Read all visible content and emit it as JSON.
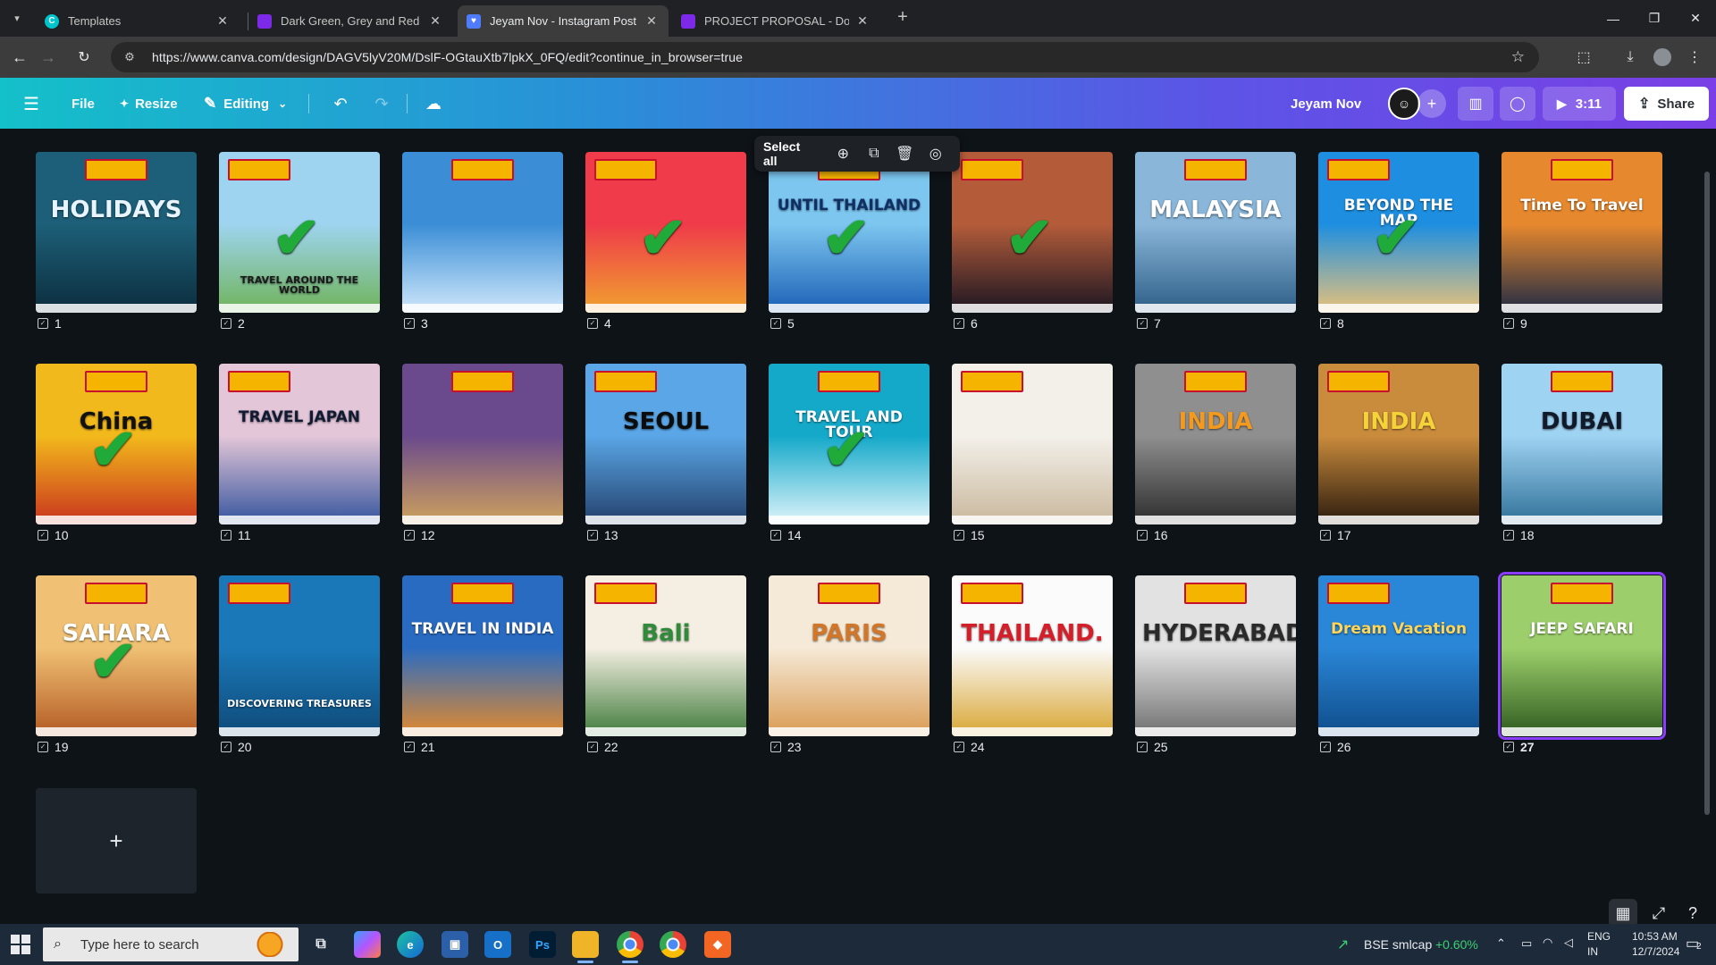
{
  "browser": {
    "tabs": [
      {
        "title": "Templates",
        "active": false,
        "favicon": "canva-icon",
        "color": "#00c4cc"
      },
      {
        "title": "Dark Green, Grey and Red Modern",
        "active": false,
        "favicon": "doc-icon",
        "color": "#7d2ae8"
      },
      {
        "title": "Jeyam Nov - Instagram Post - C",
        "active": true,
        "favicon": "heart-icon",
        "color": "#4f7bff"
      },
      {
        "title": "PROJECT PROPOSAL - Doc",
        "active": false,
        "favicon": "doc-icon",
        "color": "#7d2ae8"
      }
    ],
    "url": "https://www.canva.com/design/DAGV5lyV20M/DslF-OGtauXtb7lpkX_0FQ/edit?continue_in_browser=true"
  },
  "header": {
    "file_label": "File",
    "resize_label": "Resize",
    "editing_label": "Editing",
    "design_title": "Jeyam Nov",
    "play_time": "3:11",
    "share_label": "Share"
  },
  "selection_toolbar": {
    "select_all_label": "Select all"
  },
  "pages": [
    {
      "num": "1",
      "title": "HOLIDAYS",
      "bg": "#1d5f78",
      "bg2": "#0c2d3d",
      "title_color": "#e8f4ff",
      "checked": false
    },
    {
      "num": "2",
      "title": "TRAVEL AROUND THE WORLD",
      "bg": "#9ed4ef",
      "bg2": "#6fb35a",
      "title_color": "#1a1a1a",
      "checked": true
    },
    {
      "num": "3",
      "title": "",
      "bg": "#3b8ed6",
      "bg2": "#cfe7fb",
      "title_color": "#ffffff",
      "checked": false
    },
    {
      "num": "4",
      "title": "",
      "bg": "#ef3b4a",
      "bg2": "#f0a22e",
      "title_color": "#ffffff",
      "checked": true
    },
    {
      "num": "5",
      "title": "UNTIL THAILAND",
      "bg": "#7cc6ef",
      "bg2": "#1a5fb5",
      "title_color": "#0f2f66",
      "checked": true
    },
    {
      "num": "6",
      "title": "",
      "bg": "#b45c3a",
      "bg2": "#1b1522",
      "title_color": "#ffffff",
      "checked": true
    },
    {
      "num": "7",
      "title": "MALAYSIA",
      "bg": "#89b6d9",
      "bg2": "#2d5d86",
      "title_color": "#ffffff",
      "checked": false
    },
    {
      "num": "8",
      "title": "BEYOND THE MAP",
      "bg": "#1e8fe0",
      "bg2": "#e9c27a",
      "title_color": "#ffffff",
      "checked": true
    },
    {
      "num": "9",
      "title": "Time To Travel",
      "bg": "#e6882e",
      "bg2": "#1f2a44",
      "title_color": "#ffffff",
      "checked": false
    },
    {
      "num": "10",
      "title": "China",
      "bg": "#f2b91c",
      "bg2": "#c9331e",
      "title_color": "#111111",
      "checked": true
    },
    {
      "num": "11",
      "title": "TRAVEL JAPAN",
      "bg": "#e3c6d8",
      "bg2": "#35549d",
      "title_color": "#111a33",
      "checked": false
    },
    {
      "num": "12",
      "title": "",
      "bg": "#6a4a8c",
      "bg2": "#cfa35c",
      "title_color": "#ffffff",
      "checked": false
    },
    {
      "num": "13",
      "title": "SEOUL",
      "bg": "#5aa6e6",
      "bg2": "#23406b",
      "title_color": "#0c0c0c",
      "checked": false
    },
    {
      "num": "14",
      "title": "TRAVEL AND TOUR",
      "bg": "#14a9c9",
      "bg2": "#e0f4fb",
      "title_color": "#ffffff",
      "checked": true
    },
    {
      "num": "15",
      "title": "",
      "bg": "#f3f0ea",
      "bg2": "#c9b79c",
      "title_color": "#333333",
      "checked": false
    },
    {
      "num": "16",
      "title": "INDIA",
      "bg": "#8f8f8f",
      "bg2": "#2b2b2b",
      "title_color": "#f39a1e",
      "checked": false
    },
    {
      "num": "17",
      "title": "INDIA",
      "bg": "#c98b3c",
      "bg2": "#2a1a0d",
      "title_color": "#f3d23a",
      "checked": false
    },
    {
      "num": "18",
      "title": "DUBAI",
      "bg": "#9fd3f2",
      "bg2": "#2f6f98",
      "title_color": "#101a2a",
      "checked": false
    },
    {
      "num": "19",
      "title": "SAHARA",
      "bg": "#f0c174",
      "bg2": "#b35a24",
      "title_color": "#ffffff",
      "checked": true
    },
    {
      "num": "20",
      "title": "DISCOVERING TREASURES",
      "bg": "#1a78b8",
      "bg2": "#0f4a78",
      "title_color": "#ffffff",
      "checked": false
    },
    {
      "num": "21",
      "title": "TRAVEL IN INDIA",
      "bg": "#2a6bc2",
      "bg2": "#e38a2d",
      "title_color": "#ffffff",
      "checked": false
    },
    {
      "num": "22",
      "title": "Bali",
      "bg": "#f4efe2",
      "bg2": "#3f7a3a",
      "title_color": "#2f8a3a",
      "checked": false
    },
    {
      "num": "23",
      "title": "PARIS",
      "bg": "#f5ead7",
      "bg2": "#d99a52",
      "title_color": "#d2762a",
      "checked": false
    },
    {
      "num": "24",
      "title": "THAILAND.",
      "bg": "#fbfbfb",
      "bg2": "#d8a531",
      "title_color": "#d41f2a",
      "checked": false
    },
    {
      "num": "25",
      "title": "HYDERABAD",
      "bg": "#e2e2e2",
      "bg2": "#6e6e6e",
      "title_color": "#2a2a2a",
      "checked": false
    },
    {
      "num": "26",
      "title": "Dream Vacation",
      "bg": "#2a86d6",
      "bg2": "#0f4c8a",
      "title_color": "#ffd65a",
      "checked": false
    },
    {
      "num": "27",
      "title": "JEEP SAFARI",
      "bg": "#9ccf6b",
      "bg2": "#2f5a1f",
      "title_color": "#ffffff",
      "checked": false,
      "selected": true
    }
  ],
  "taskbar": {
    "search_placeholder": "Type here to search",
    "ticker_name": "BSE smlcap",
    "ticker_change": "+0.60%",
    "ticker_color": "#3bd16f",
    "lang_line1": "ENG",
    "lang_line2": "IN",
    "time": "10:53 AM",
    "date": "12/7/2024",
    "notif_count": "2"
  }
}
